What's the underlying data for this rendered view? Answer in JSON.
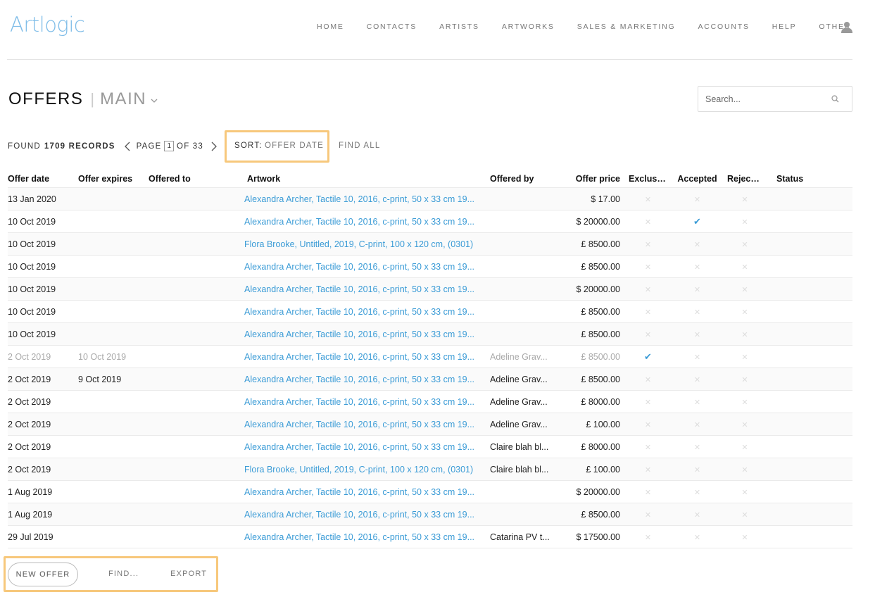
{
  "brand": {
    "logo_text": "Artlogic",
    "accent": "#7fbde8",
    "link_color": "#3a9bd6",
    "highlight_color": "#f7c87c"
  },
  "nav": [
    "HOME",
    "CONTACTS",
    "ARTISTS",
    "ARTWORKS",
    "SALES & MARKETING",
    "ACCOUNTS",
    "HELP",
    "OTHER"
  ],
  "page": {
    "title": "OFFERS",
    "view": "MAIN"
  },
  "search": {
    "placeholder": "Search..."
  },
  "records": {
    "found_label": "FOUND",
    "found_count": "1709 RECORDS",
    "page_label": "PAGE",
    "page_current": "1",
    "page_total": "OF 33",
    "sort_label": "SORT:",
    "sort_value": "OFFER DATE",
    "find_all": "FIND ALL"
  },
  "table": {
    "columns": [
      "Offer date",
      "Offer expires",
      "Offered to",
      "Artwork",
      "Offered by",
      "Offer price",
      "Exclusive",
      "Accepted",
      "Rejected",
      "Status"
    ],
    "rows": [
      {
        "date": "13 Jan 2020",
        "expires": "",
        "to": "",
        "artwork": "Alexandra Archer, Tactile 10, 2016, c-print, 50 x 33 cm 19...",
        "by": "",
        "price": "$ 17.00",
        "exclusive": "✕",
        "accepted": "✕",
        "rejected": "✕",
        "status": ""
      },
      {
        "date": "10 Oct 2019",
        "expires": "",
        "to": "",
        "artwork": "Alexandra Archer, Tactile 10, 2016, c-print, 50 x 33 cm 19...",
        "by": "",
        "price": "$ 20000.00",
        "exclusive": "✕",
        "accepted": "✔",
        "rejected": "✕",
        "status": ""
      },
      {
        "date": "10 Oct 2019",
        "expires": "",
        "to": "",
        "artwork": "Flora Brooke, Untitled, 2019, C-print, 100 x 120 cm, (0301)",
        "by": "",
        "price": "£ 8500.00",
        "exclusive": "✕",
        "accepted": "✕",
        "rejected": "✕",
        "status": ""
      },
      {
        "date": "10 Oct 2019",
        "expires": "",
        "to": "",
        "artwork": "Alexandra Archer, Tactile 10, 2016, c-print, 50 x 33 cm 19...",
        "by": "",
        "price": "£ 8500.00",
        "exclusive": "✕",
        "accepted": "✕",
        "rejected": "✕",
        "status": ""
      },
      {
        "date": "10 Oct 2019",
        "expires": "",
        "to": "",
        "artwork": "Alexandra Archer, Tactile 10, 2016, c-print, 50 x 33 cm 19...",
        "by": "",
        "price": "$ 20000.00",
        "exclusive": "✕",
        "accepted": "✕",
        "rejected": "✕",
        "status": ""
      },
      {
        "date": "10 Oct 2019",
        "expires": "",
        "to": "",
        "artwork": "Alexandra Archer, Tactile 10, 2016, c-print, 50 x 33 cm 19...",
        "by": "",
        "price": "£ 8500.00",
        "exclusive": "✕",
        "accepted": "✕",
        "rejected": "✕",
        "status": ""
      },
      {
        "date": "10 Oct 2019",
        "expires": "",
        "to": "",
        "artwork": "Alexandra Archer, Tactile 10, 2016, c-print, 50 x 33 cm 19...",
        "by": "",
        "price": "£ 8500.00",
        "exclusive": "✕",
        "accepted": "✕",
        "rejected": "✕",
        "status": ""
      },
      {
        "date": "2 Oct 2019",
        "expires": "10 Oct 2019",
        "to": "",
        "artwork": "Alexandra Archer, Tactile 10, 2016, c-print, 50 x 33 cm 19...",
        "by": "Adeline Grav...",
        "price": "£ 8500.00",
        "exclusive": "✔",
        "accepted": "✕",
        "rejected": "✕",
        "status": "",
        "faded": true
      },
      {
        "date": "2 Oct 2019",
        "expires": "9 Oct 2019",
        "to": "",
        "artwork": "Alexandra Archer, Tactile 10, 2016, c-print, 50 x 33 cm 19...",
        "by": "Adeline Grav...",
        "price": "£ 8500.00",
        "exclusive": "✕",
        "accepted": "✕",
        "rejected": "✕",
        "status": ""
      },
      {
        "date": "2 Oct 2019",
        "expires": "",
        "to": "",
        "artwork": "Alexandra Archer, Tactile 10, 2016, c-print, 50 x 33 cm 19...",
        "by": "Adeline Grav...",
        "price": "£ 8000.00",
        "exclusive": "✕",
        "accepted": "✕",
        "rejected": "✕",
        "status": ""
      },
      {
        "date": "2 Oct 2019",
        "expires": "",
        "to": "",
        "artwork": "Alexandra Archer, Tactile 10, 2016, c-print, 50 x 33 cm 19...",
        "by": "Adeline Grav...",
        "price": "£ 100.00",
        "exclusive": "✕",
        "accepted": "✕",
        "rejected": "✕",
        "status": ""
      },
      {
        "date": "2 Oct 2019",
        "expires": "",
        "to": "",
        "artwork": "Alexandra Archer, Tactile 10, 2016, c-print, 50 x 33 cm 19...",
        "by": "Claire blah bl...",
        "price": "£ 8000.00",
        "exclusive": "✕",
        "accepted": "✕",
        "rejected": "✕",
        "status": ""
      },
      {
        "date": "2 Oct 2019",
        "expires": "",
        "to": "",
        "artwork": "Flora Brooke, Untitled, 2019, C-print, 100 x 120 cm, (0301)",
        "by": "Claire blah bl...",
        "price": "£ 100.00",
        "exclusive": "✕",
        "accepted": "✕",
        "rejected": "✕",
        "status": ""
      },
      {
        "date": "1 Aug 2019",
        "expires": "",
        "to": "",
        "artwork": "Alexandra Archer, Tactile 10, 2016, c-print, 50 x 33 cm 19...",
        "by": "",
        "price": "$ 20000.00",
        "exclusive": "✕",
        "accepted": "✕",
        "rejected": "✕",
        "status": ""
      },
      {
        "date": "1 Aug 2019",
        "expires": "",
        "to": "",
        "artwork": "Alexandra Archer, Tactile 10, 2016, c-print, 50 x 33 cm 19...",
        "by": "",
        "price": "£ 8500.00",
        "exclusive": "✕",
        "accepted": "✕",
        "rejected": "✕",
        "status": ""
      },
      {
        "date": "29 Jul 2019",
        "expires": "",
        "to": "",
        "artwork": "Alexandra Archer, Tactile 10, 2016, c-print, 50 x 33 cm 19...",
        "by": "Catarina PV t...",
        "price": "$ 17500.00",
        "exclusive": "✕",
        "accepted": "✕",
        "rejected": "✕",
        "status": ""
      }
    ]
  },
  "actions": {
    "new_offer": "NEW OFFER",
    "find": "FIND...",
    "export": "EXPORT"
  }
}
